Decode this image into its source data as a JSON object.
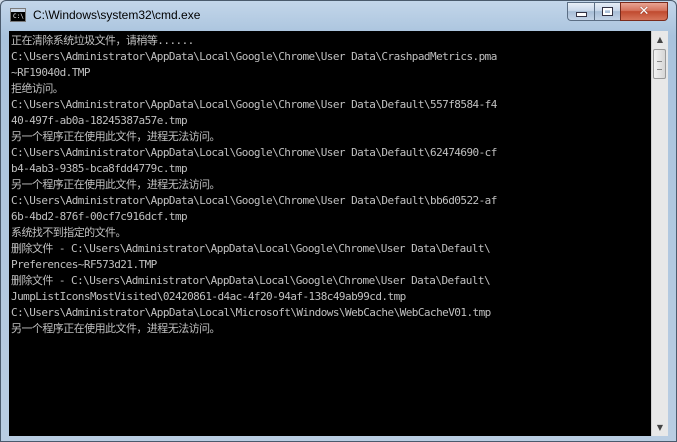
{
  "window": {
    "title": "C:\\Windows\\system32\\cmd.exe",
    "app_icon_label": "C:\\"
  },
  "console": {
    "lines": [
      "正在清除系统垃圾文件，请稍等......",
      "C:\\Users\\Administrator\\AppData\\Local\\Google\\Chrome\\User Data\\CrashpadMetrics.pma",
      "~RF19040d.TMP",
      "拒绝访问。",
      "C:\\Users\\Administrator\\AppData\\Local\\Google\\Chrome\\User Data\\Default\\557f8584-f4",
      "40-497f-ab0a-18245387a57e.tmp",
      "另一个程序正在使用此文件，进程无法访问。",
      "C:\\Users\\Administrator\\AppData\\Local\\Google\\Chrome\\User Data\\Default\\62474690-cf",
      "b4-4ab3-9385-bca8fdd4779c.tmp",
      "另一个程序正在使用此文件，进程无法访问。",
      "C:\\Users\\Administrator\\AppData\\Local\\Google\\Chrome\\User Data\\Default\\bb6d0522-af",
      "6b-4bd2-876f-00cf7c916dcf.tmp",
      "系统找不到指定的文件。",
      "删除文件 - C:\\Users\\Administrator\\AppData\\Local\\Google\\Chrome\\User Data\\Default\\",
      "Preferences~RF573d21.TMP",
      "删除文件 - C:\\Users\\Administrator\\AppData\\Local\\Google\\Chrome\\User Data\\Default\\",
      "JumpListIconsMostVisited\\02420861-d4ac-4f20-94af-138c49ab99cd.tmp",
      "C:\\Users\\Administrator\\AppData\\Local\\Microsoft\\Windows\\WebCache\\WebCacheV01.tmp",
      "另一个程序正在使用此文件，进程无法访问。"
    ]
  },
  "controls": {
    "minimize_icon": "minimize-icon",
    "maximize_icon": "maximize-icon",
    "close_icon": "close-icon",
    "close_glyph": "✕",
    "scroll_up_glyph": "▲",
    "scroll_down_glyph": "▼"
  },
  "colors": {
    "console_bg": "#000000",
    "console_text": "#c0c0c0",
    "close_button": "#c94a30"
  }
}
